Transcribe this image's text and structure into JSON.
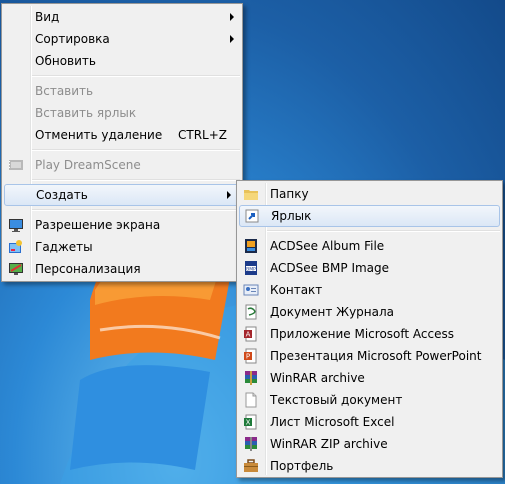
{
  "context_menu": {
    "items": [
      {
        "label": "Вид"
      },
      {
        "label": "Сортировка"
      },
      {
        "label": "Обновить"
      },
      {
        "label": "Вставить"
      },
      {
        "label": "Вставить ярлык"
      },
      {
        "label": "Отменить удаление",
        "shortcut": "CTRL+Z"
      },
      {
        "label": "Play DreamScene"
      },
      {
        "label": "Создать"
      },
      {
        "label": "Разрешение экрана"
      },
      {
        "label": "Гаджеты"
      },
      {
        "label": "Персонализация"
      }
    ]
  },
  "create_submenu": {
    "items": [
      {
        "label": "Папку"
      },
      {
        "label": "Ярлык"
      },
      {
        "label": "ACDSee Album File"
      },
      {
        "label": "ACDSee BMP Image"
      },
      {
        "label": "Контакт"
      },
      {
        "label": "Документ Журнала"
      },
      {
        "label": "Приложение Microsoft Access"
      },
      {
        "label": "Презентация Microsoft PowerPoint"
      },
      {
        "label": "WinRAR archive"
      },
      {
        "label": "Текстовый документ"
      },
      {
        "label": "Лист Microsoft Excel"
      },
      {
        "label": "WinRAR ZIP archive"
      },
      {
        "label": "Портфель"
      }
    ]
  },
  "colors": {
    "desktop_bg": "#1c5fa6",
    "menu_bg": "#f0f0f0",
    "highlight": "#dbe7f6",
    "disabled_text": "#8d8d8d"
  }
}
